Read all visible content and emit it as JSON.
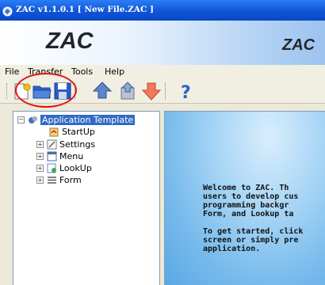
{
  "window": {
    "title": "ZAC v1.1.0.1 [ New File.ZAC ]"
  },
  "banner": {
    "logo_left": "ZAC",
    "logo_right": "ZAC"
  },
  "menu": {
    "items": [
      "File",
      "Transfer",
      "Tools",
      "Help"
    ]
  },
  "toolbar": {
    "buttons": [
      {
        "icon": "new-file-icon"
      },
      {
        "icon": "open-folder-icon"
      },
      {
        "icon": "save-icon"
      },
      {
        "icon": "upload-arrow-icon"
      },
      {
        "icon": "upload-device-icon"
      },
      {
        "icon": "download-arrow-icon"
      },
      {
        "icon": "help-icon"
      }
    ],
    "highlighted": "open-folder-icon",
    "highlight_color": "#e01818"
  },
  "tree": {
    "root": {
      "label": "Application Template",
      "selected": true,
      "expander": "⊟"
    },
    "children": [
      {
        "label": "StartUp",
        "expander": ""
      },
      {
        "label": "Settings",
        "expander": "+"
      },
      {
        "label": "Menu",
        "expander": "+"
      },
      {
        "label": "LookUp",
        "expander": "+"
      },
      {
        "label": "Form",
        "expander": "+"
      }
    ]
  },
  "welcome": {
    "lines": [
      "Welcome to ZAC. Th",
      "users to develop cus",
      "programming backgr",
      "Form, and Lookup ta",
      "",
      "To get started, click",
      "screen or simply pre",
      "application."
    ]
  },
  "colors": {
    "title_bar": "#0f56d8",
    "selection": "#316ac5",
    "content_bg": "#78bbec"
  }
}
